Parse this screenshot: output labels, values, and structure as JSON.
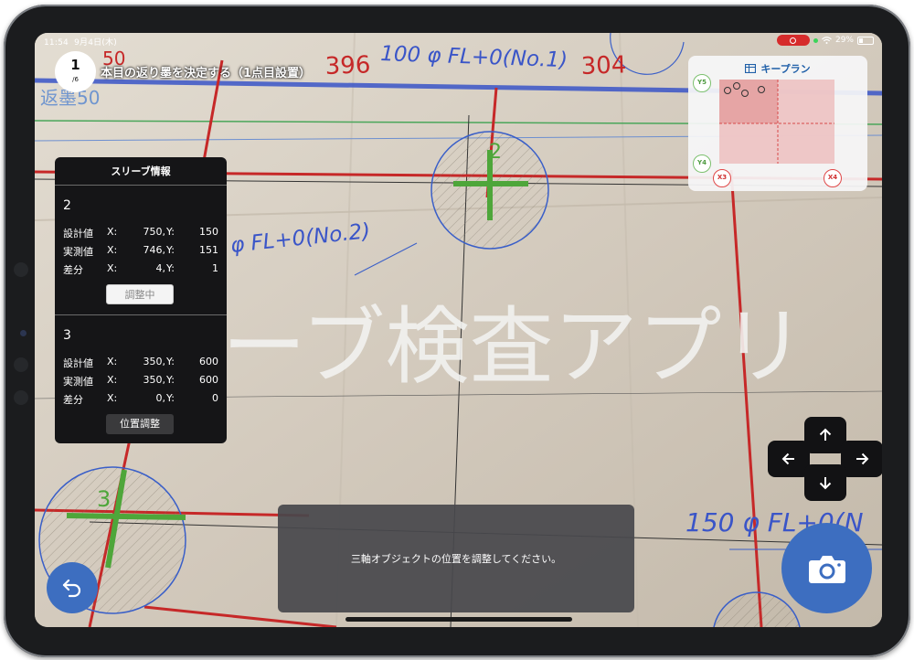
{
  "status_bar": {
    "time": "11:54",
    "date": "9月4日(木)",
    "battery": "29%"
  },
  "step": {
    "current": "1",
    "total": "/6",
    "instruction": "本目の返り墨を決定する（1点目設置）"
  },
  "drawing_labels": {
    "dim_396": "396",
    "dim_304": "304",
    "pipe_no1": "100 φ  FL+0(No.1)",
    "pipe_no2": "φ  FL+0(No.2)",
    "pipe_bottom": "150 φ  FL+0(N",
    "return_ink_top": "50",
    "return_ink_left": "返墨50",
    "watermark": "ーブ検査アプリ",
    "sleeve_num_2": "2",
    "sleeve_num_3": "3"
  },
  "sleeve_panel": {
    "title": "スリーブ情報",
    "column_x": "X:",
    "column_y": "Y:",
    "sleeves": [
      {
        "id": "2",
        "rows": [
          {
            "label": "設計値",
            "x": "750,",
            "y": "150"
          },
          {
            "label": "実測値",
            "x": "746,",
            "y": "151"
          },
          {
            "label": "差分",
            "x": "4,",
            "y": "1"
          }
        ],
        "button": "調整中"
      },
      {
        "id": "3",
        "rows": [
          {
            "label": "設計値",
            "x": "350,",
            "y": "600"
          },
          {
            "label": "実測値",
            "x": "350,",
            "y": "600"
          },
          {
            "label": "差分",
            "x": "0,",
            "y": "0"
          }
        ],
        "button": "位置調整"
      }
    ]
  },
  "keyplan": {
    "title": "キープラン",
    "axes": {
      "y5": "Y5",
      "y4": "Y4",
      "x3": "X3",
      "x4": "X4"
    }
  },
  "message": "三軸オブジェクトの位置を調整してください。",
  "icons": {
    "keyplan": "grid-icon",
    "dpad": [
      "arrow-up-icon",
      "arrow-left-icon",
      "arrow-right-icon",
      "arrow-down-icon"
    ],
    "back": "undo-arrow-icon",
    "camera": "camera-icon"
  },
  "colors": {
    "accent_blue": "#3d6ec0",
    "keyplan_title": "#1f5fa8",
    "drawing_red": "#c62828",
    "drawing_blue": "#3a5fc8",
    "axis_green": "#4ea63a",
    "panel_bg": "#151517"
  }
}
